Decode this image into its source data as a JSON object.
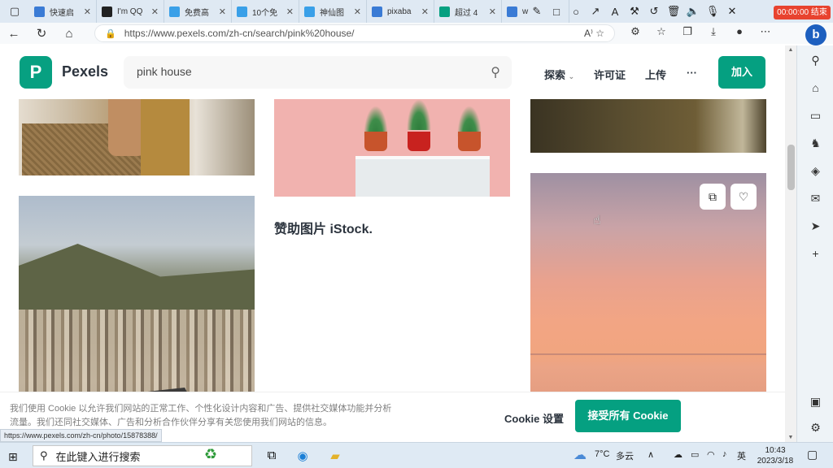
{
  "browser": {
    "tabs": [
      {
        "title": "快速启",
        "icon": "search-icon",
        "color": "#3a7bd5"
      },
      {
        "title": "I'm QQ",
        "icon": "qq-icon",
        "color": "#222222"
      },
      {
        "title": "免费高",
        "icon": "tv-icon",
        "color": "#3aa0e8"
      },
      {
        "title": "10个免",
        "icon": "tv-icon",
        "color": "#3aa0e8"
      },
      {
        "title": "神仙图",
        "icon": "tv-icon",
        "color": "#3aa0e8"
      },
      {
        "title": "pixaba",
        "icon": "search-icon",
        "color": "#3a7bd5"
      },
      {
        "title": "超过 4",
        "icon": "pexels-icon",
        "color": "#05a081"
      },
      {
        "title": "w",
        "icon": "search-icon",
        "color": "#3a7bd5"
      }
    ],
    "url": "https://www.pexels.com/zh-cn/search/pink%20house/",
    "recording_badge": "00:00:00 结束"
  },
  "header": {
    "logo_letter": "P",
    "brand": "Pexels",
    "search_value": "pink house",
    "nav": {
      "explore": "探索",
      "license": "许可证",
      "upload": "上传",
      "more": "···",
      "join": "加入"
    }
  },
  "main": {
    "sponsor_text": "赞助图片 iStock."
  },
  "cookie": {
    "text": "我们使用 Cookie 以允许我们网站的正常工作、个性化设计内容和广告、提供社交媒体功能并分析流量。我们还同社交媒体、广告和分析合作伙伴分享有关您使用我们网站的信息。",
    "settings": "Cookie 设置",
    "accept": "接受所有 Cookie"
  },
  "status_url": "https://www.pexels.com/zh-cn/photo/15878388/",
  "taskbar": {
    "search_placeholder": "在此键入进行搜索",
    "weather_temp": "7°C",
    "weather_desc": "多云",
    "ime": "英",
    "time": "10:43",
    "date": "2023/3/18"
  },
  "colors": {
    "brand_green": "#05a081",
    "record_red": "#e8432f"
  }
}
